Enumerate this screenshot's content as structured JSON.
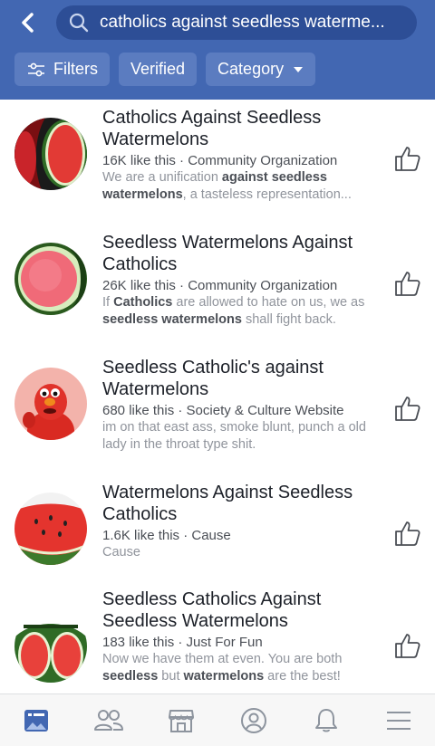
{
  "search": {
    "query": "catholics against seedless waterme..."
  },
  "filters": {
    "filters_label": "Filters",
    "verified_label": "Verified",
    "category_label": "Category"
  },
  "results": [
    {
      "title": "Catholics Against Seedless Watermelons",
      "meta": "16K like this · Community Organization",
      "snippet_parts": [
        {
          "t": "We are a unification ",
          "b": false
        },
        {
          "t": "against seedless watermelons",
          "b": true
        },
        {
          "t": ", a tasteless representation...",
          "b": false
        }
      ]
    },
    {
      "title": "Seedless Watermelons Against Catholics",
      "meta": "26K like this · Community Organization",
      "snippet_parts": [
        {
          "t": "If ",
          "b": false
        },
        {
          "t": "Catholics",
          "b": true
        },
        {
          "t": " are allowed to hate on us, we as ",
          "b": false
        },
        {
          "t": "seedless watermelons",
          "b": true
        },
        {
          "t": " shall fight back.",
          "b": false
        }
      ]
    },
    {
      "title": "Seedless Catholic's against Watermelons",
      "meta": "680 like this · Society & Culture Website",
      "snippet_parts": [
        {
          "t": "im on that east ass, smoke blunt, punch a old lady in the throat type shit.",
          "b": false
        }
      ]
    },
    {
      "title": "Watermelons Against Seedless Catholics",
      "meta": "1.6K like this · Cause",
      "snippet_parts": [
        {
          "t": "Cause",
          "b": false
        }
      ]
    },
    {
      "title": "Seedless Catholics Against Seedless Watermelons",
      "meta": "183 like this · Just For Fun",
      "snippet_parts": [
        {
          "t": "Now we have them at even.  You are both ",
          "b": false
        },
        {
          "t": "seedless",
          "b": true
        },
        {
          "t": " but ",
          "b": false
        },
        {
          "t": "watermelons",
          "b": true
        },
        {
          "t": " are the best!",
          "b": false
        }
      ]
    }
  ],
  "colors": {
    "header_bg": "#4267b2",
    "search_bg": "#2d4e96",
    "chip_bg": "#5b7cc0",
    "nav_active": "#4267b2",
    "nav_inactive": "#8d949e"
  },
  "icons": {
    "back": "chevron-left-icon",
    "search": "magnifier-icon",
    "filters": "sliders-icon",
    "category_caret": "caret-down-icon",
    "like": "thumbs-up-icon",
    "nav": [
      "news-feed-icon",
      "friends-icon",
      "marketplace-icon",
      "profile-icon",
      "bell-icon",
      "menu-icon"
    ]
  }
}
